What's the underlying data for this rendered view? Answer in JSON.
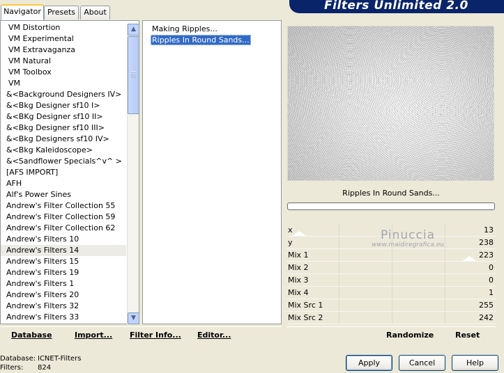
{
  "tabs": [
    "Navigator",
    "Presets",
    "About"
  ],
  "app_title": "Filters Unlimited 2.0",
  "categories": [
    {
      "label": "VM Distortion",
      "indent": true
    },
    {
      "label": "VM Experimental",
      "indent": true
    },
    {
      "label": "VM Extravaganza",
      "indent": true
    },
    {
      "label": "VM Natural",
      "indent": true
    },
    {
      "label": "VM Toolbox",
      "indent": true
    },
    {
      "label": "VM",
      "indent": true
    },
    {
      "label": "&<Background Designers IV>"
    },
    {
      "label": "&<Bkg Designer sf10 I>"
    },
    {
      "label": "&<BKg Designer sf10 II>"
    },
    {
      "label": "&<Bkg Designer sf10 III>"
    },
    {
      "label": "&<Bkg Designers sf10 IV>"
    },
    {
      "label": "&<Bkg Kaleidoscope>"
    },
    {
      "label": "&<Sandflower Specials^v^ >"
    },
    {
      "label": "[AFS IMPORT]"
    },
    {
      "label": "AFH"
    },
    {
      "label": "Alf's Power Sines"
    },
    {
      "label": "Andrew's Filter Collection 55"
    },
    {
      "label": "Andrew's Filter Collection 59"
    },
    {
      "label": "Andrew's Filter Collection 62"
    },
    {
      "label": "Andrew's Filters 10"
    },
    {
      "label": "Andrew's Filters 14",
      "selected": true
    },
    {
      "label": "Andrew's Filters 15"
    },
    {
      "label": "Andrew's Filters 19"
    },
    {
      "label": "Andrew's Filters 1"
    },
    {
      "label": "Andrew's Filters 20"
    },
    {
      "label": "Andrew's Filters 32"
    },
    {
      "label": "Andrew's Filters 33"
    }
  ],
  "filters": [
    {
      "label": "Making Ripples..."
    },
    {
      "label": "Ripples In Round Sands...",
      "selected": true
    }
  ],
  "preview_filter_name": "Ripples In Round Sands...",
  "params": [
    {
      "label": "x",
      "value": "13"
    },
    {
      "label": "y",
      "value": "238"
    },
    {
      "label": "Mix 1",
      "value": "223"
    },
    {
      "label": "Mix 2",
      "value": "0"
    },
    {
      "label": "Mix 3",
      "value": "0"
    },
    {
      "label": "Mix 4",
      "value": "1"
    },
    {
      "label": "Mix Src 1",
      "value": "255"
    },
    {
      "label": "Mix Src 2",
      "value": "242"
    }
  ],
  "watermark": {
    "name": "Pinuccia",
    "url": "www.maidiregrafica.eu"
  },
  "left_toolbar": {
    "database": "Database",
    "import": "Import...",
    "filter_info": "Filter Info...",
    "editor": "Editor..."
  },
  "right_toolbar": {
    "randomize": "Randomize",
    "reset": "Reset"
  },
  "status": {
    "database_label": "Database:",
    "database_value": "ICNET-Filters",
    "filters_label": "Filters:",
    "filters_value": "824"
  },
  "buttons": {
    "apply": "Apply",
    "cancel": "Cancel",
    "help": "Help"
  },
  "colors": {
    "selection": "#316ac5",
    "banner": "#0a246a",
    "face": "#ece9d8"
  },
  "icons": {
    "scroll_up": "arrow-up-icon",
    "scroll_down": "arrow-down-icon"
  }
}
